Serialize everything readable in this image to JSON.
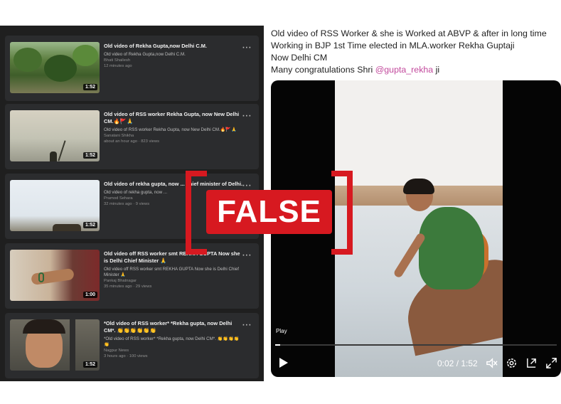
{
  "left_panel": {
    "results": [
      {
        "title": "Old video of Rekha Gupta,now Delhi C.M.",
        "description": "Old video of Rekha Gupta,now Delhi C.M.",
        "channel": "Bhati Shailesh",
        "meta": "12 minutes ago",
        "duration": "1:52",
        "thumbnail_icon": "jungle-thumbnail"
      },
      {
        "title": "Old video of RSS worker Rekha Gupta, now New Delhi CM.🔥🚩🙏",
        "description": "Old video of RSS worker Rekha Gupta, now New Delhi CM.🔥🚩🙏",
        "channel": "Sanatani Shikha",
        "meta": "about an hour ago · 823 views",
        "duration": "1:52",
        "thumbnail_icon": "sky-thumbnail"
      },
      {
        "title": "Old video of rekha gupta, now ... chief minister of Delhi.",
        "description": "Old video of rekha gupta, now ...",
        "channel": "Pramod Sehara",
        "meta": "32 minutes ago · 9 views",
        "duration": "1:52",
        "thumbnail_icon": "pale-thumbnail"
      },
      {
        "title": "Old video off RSS worker smt REKHA GUPTA Now she is Delhi Chief Minister 🙏",
        "description": "Old video off RSS worker smt REKHA GUPTA Now she is Delhi Chief Minister 🙏",
        "channel": "Pankaj Bhatnagar",
        "meta": "35 minutes ago · 29 views",
        "duration": "1:00",
        "thumbnail_icon": "hand-thumbnail"
      },
      {
        "title": "*Old video of RSS worker* *Rekha gupta, now Delhi CM*. 👏👏👏👏👏👏",
        "description": "*Old video of RSS worker* *Rekha gupta, now Delhi CM*. 👏👏👏👏👏",
        "channel": "Nagpur News",
        "meta": "3 hours ago · 100 views",
        "duration": "1:52",
        "thumbnail_icon": "face-thumbnail"
      }
    ],
    "menu_label": "···"
  },
  "tweet": {
    "line1": "Old video of RSS Worker & she is Worked at ABVP & after in long time",
    "line2": "Working in BJP 1st Time elected in MLA.worker Rekha Guptaji",
    "line3": "Now Delhi CM",
    "line4_prefix": "Many congratulations Shri ",
    "handle": "@gupta_rekha",
    "line4_suffix": " ji"
  },
  "video_player": {
    "play_label": "Play",
    "time_display": "0:02 / 1:52",
    "progress_fraction": 0.018,
    "icons": [
      "play-icon",
      "volume-muted-icon",
      "settings-icon",
      "pip-icon",
      "fullscreen-icon"
    ]
  },
  "stamp": {
    "label": "FALSE",
    "color": "#d71920"
  },
  "colors": {
    "left_bg": "#1f1f1f",
    "card_bg": "#2b2c2e",
    "handle_color": "#c2489c"
  }
}
